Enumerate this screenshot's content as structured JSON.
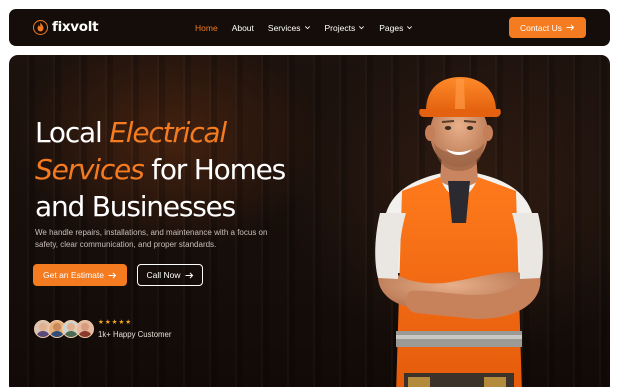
{
  "brand": {
    "name": "fixvolt",
    "icon": "flame-icon",
    "accent_color": "#f47b20"
  },
  "nav": {
    "items": [
      {
        "label": "Home",
        "active": true,
        "has_dropdown": false
      },
      {
        "label": "About",
        "active": false,
        "has_dropdown": false
      },
      {
        "label": "Services",
        "active": false,
        "has_dropdown": true
      },
      {
        "label": "Projects",
        "active": false,
        "has_dropdown": true
      },
      {
        "label": "Pages",
        "active": false,
        "has_dropdown": true
      }
    ],
    "cta_label": "Contact Us",
    "cta_icon": "arrow-right-icon"
  },
  "hero": {
    "headline": {
      "part1": "Local",
      "part2": "Electrical",
      "part3": "Services",
      "part4": "for Homes",
      "part5": "and Businesses"
    },
    "subtext": "We handle repairs, installations, and maintenance with a focus on safety, clear communication, and proper standards.",
    "primary_button": "Get an Estimate",
    "secondary_button": "Call Now",
    "button_icon": "arrow-right-icon",
    "social_proof": {
      "stars": "★★★★★",
      "rating_count": 5,
      "label": "1k+ Happy Customer",
      "avatars": [
        "avatar-1",
        "avatar-2",
        "avatar-3",
        "avatar-4"
      ]
    },
    "image": "electrician-worker-photo"
  }
}
